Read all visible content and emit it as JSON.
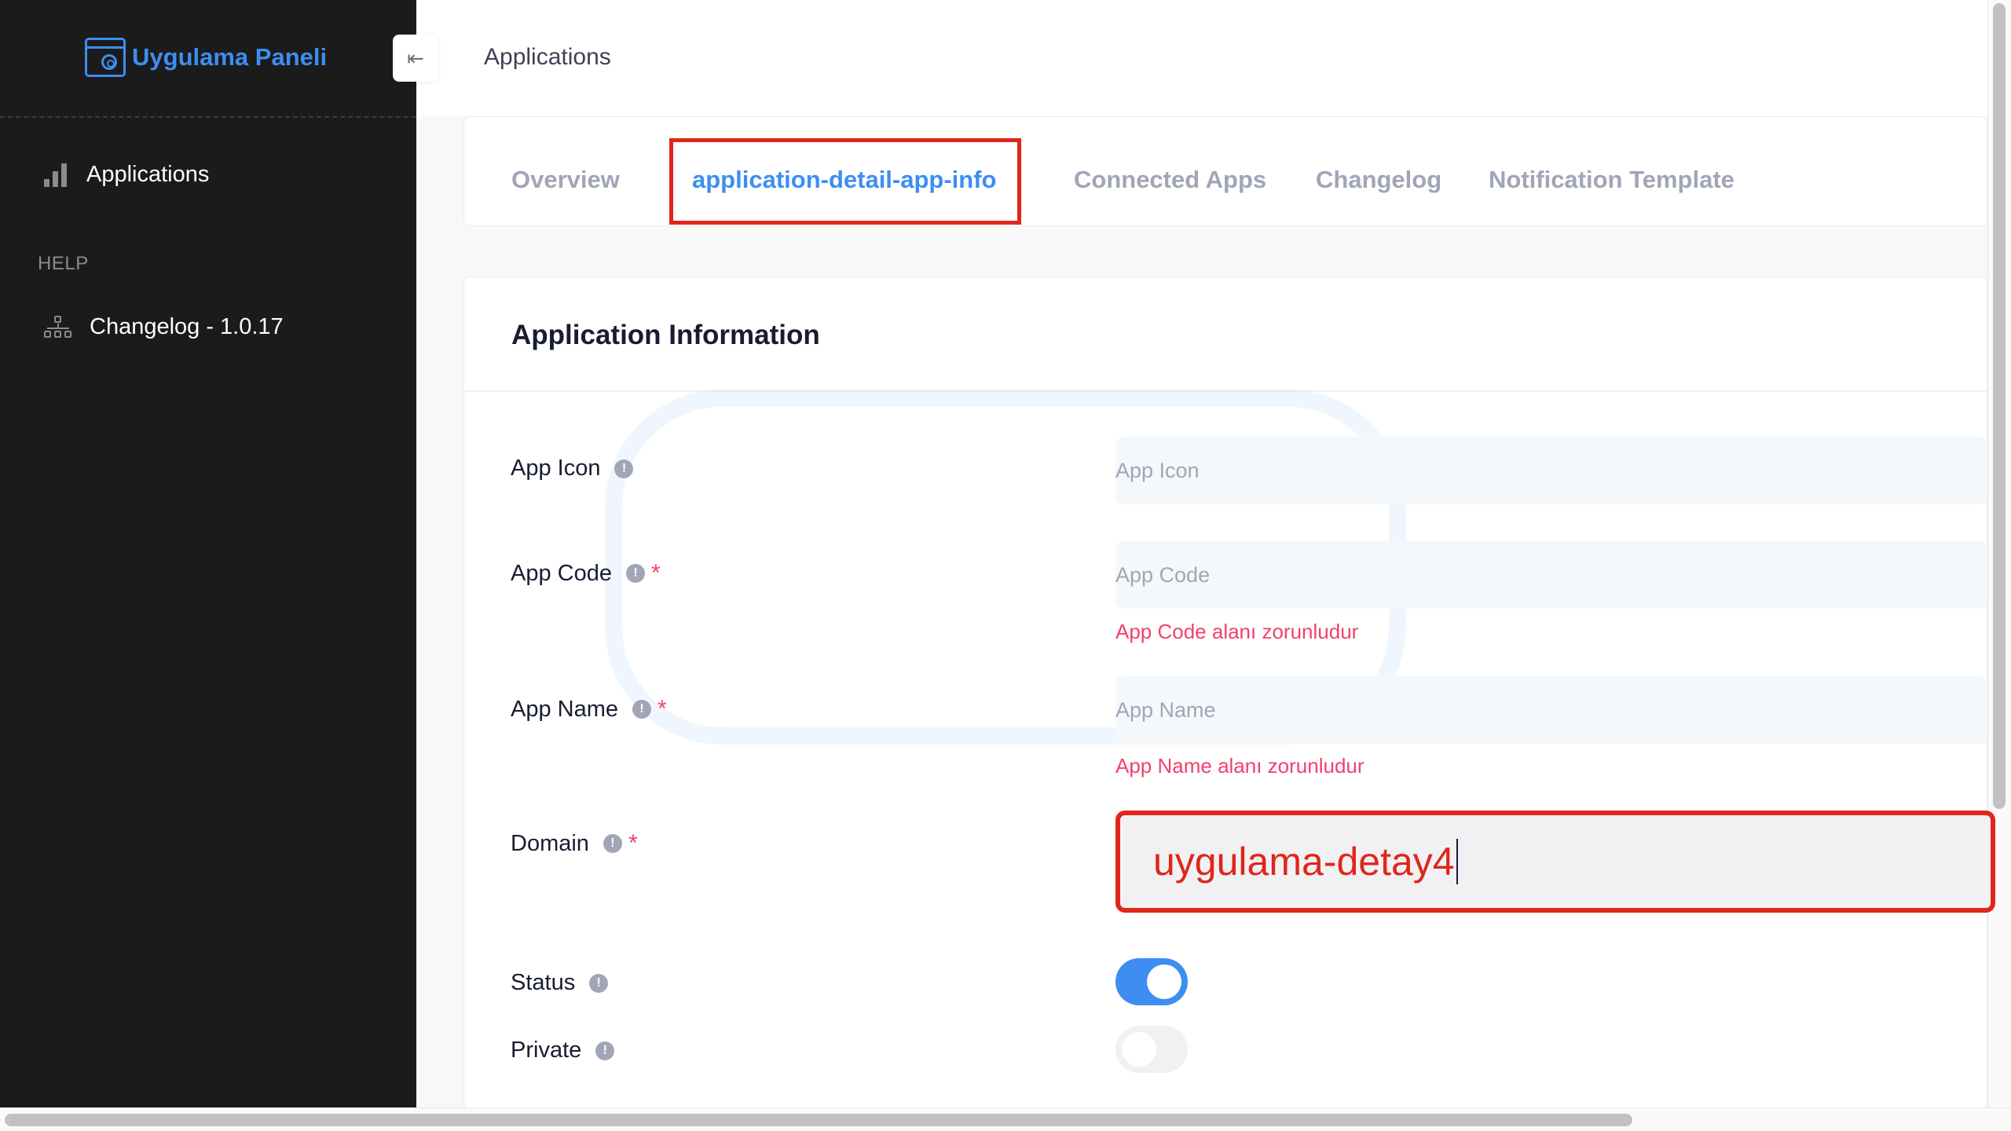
{
  "sidebar": {
    "brand": "Uygulama Paneli",
    "items": [
      {
        "label": "Applications",
        "icon": "bar-chart-icon"
      }
    ],
    "help_heading": "HELP",
    "help_items": [
      {
        "label": "Changelog - 1.0.17",
        "icon": "sitemap-icon"
      }
    ]
  },
  "header": {
    "title": "Applications",
    "collapse_icon": "arrow-left-icon"
  },
  "tabs": [
    {
      "label": "Overview",
      "active": false
    },
    {
      "label": "application-detail-app-info",
      "active": true
    },
    {
      "label": "Connected Apps",
      "active": false
    },
    {
      "label": "Changelog",
      "active": false
    },
    {
      "label": "Notification Template",
      "active": false
    }
  ],
  "form": {
    "title": "Application Information",
    "info_glyph": "!",
    "required_mark": "*",
    "app_icon": {
      "label": "App Icon",
      "placeholder": "App Icon"
    },
    "app_code": {
      "label": "App Code",
      "placeholder": "App Code",
      "error": "App Code alanı zorunludur"
    },
    "app_name": {
      "label": "App Name",
      "placeholder": "App Name",
      "error": "App Name alanı zorunludur"
    },
    "domain": {
      "label": "Domain",
      "value": "uygulama-detay4"
    },
    "status": {
      "label": "Status",
      "on": true
    },
    "private": {
      "label": "Private",
      "on": false
    }
  },
  "colors": {
    "accent": "#3d8ef0",
    "sidebar_bg": "#1b1b1c",
    "error": "#f1416c",
    "highlight_box": "#e0261b"
  }
}
